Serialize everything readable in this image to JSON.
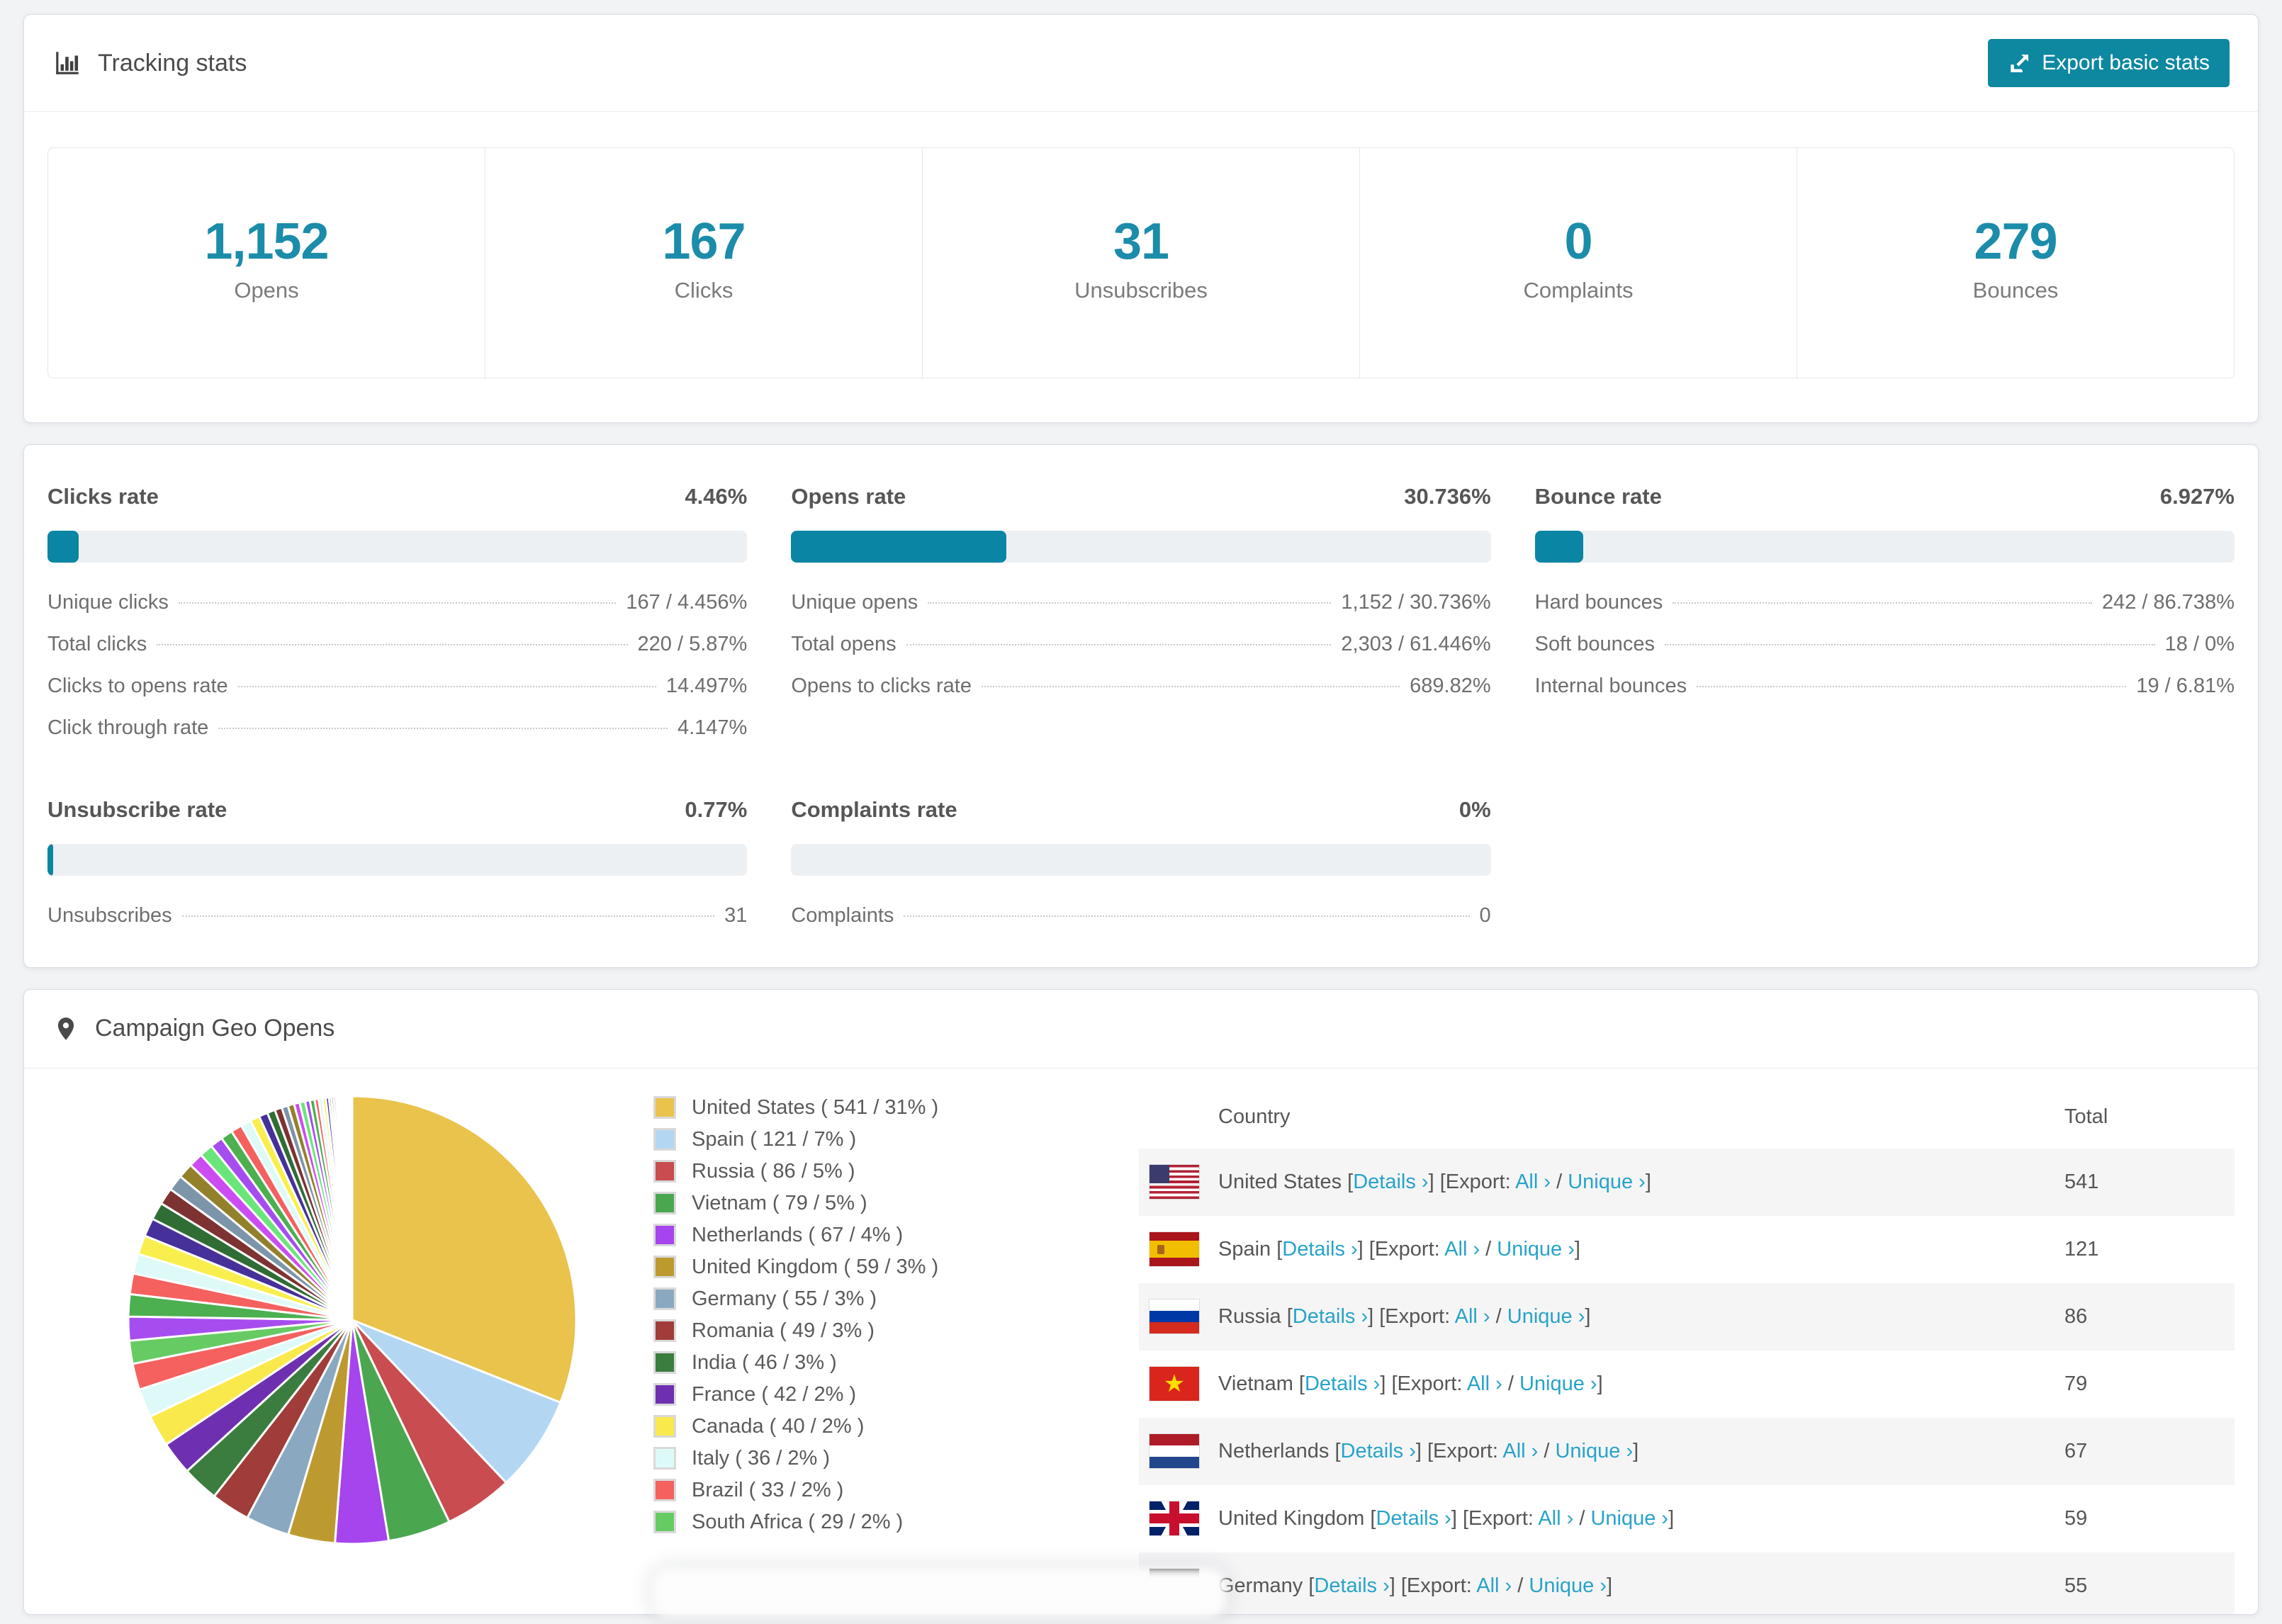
{
  "colors": {
    "accent_teal": "#0e87a1",
    "bar_fill": "#0a86a4",
    "stat_number": "#1b8ca9",
    "link": "#28a3c9",
    "row_stripe": "#f5f5f6"
  },
  "tracking": {
    "title": "Tracking stats",
    "export_button": "Export basic stats",
    "stats": [
      {
        "value": "1,152",
        "label": "Opens"
      },
      {
        "value": "167",
        "label": "Clicks"
      },
      {
        "value": "31",
        "label": "Unsubscribes"
      },
      {
        "value": "0",
        "label": "Complaints"
      },
      {
        "value": "279",
        "label": "Bounces"
      }
    ]
  },
  "rates": {
    "panels": [
      {
        "title": "Clicks rate",
        "value": "4.46%",
        "percent": 4.46,
        "rows": [
          {
            "label": "Unique clicks",
            "value": "167 / 4.456%"
          },
          {
            "label": "Total clicks",
            "value": "220 / 5.87%"
          },
          {
            "label": "Clicks to opens rate",
            "value": "14.497%"
          },
          {
            "label": "Click through rate",
            "value": "4.147%"
          }
        ]
      },
      {
        "title": "Opens rate",
        "value": "30.736%",
        "percent": 30.736,
        "rows": [
          {
            "label": "Unique opens",
            "value": "1,152 / 30.736%"
          },
          {
            "label": "Total opens",
            "value": "2,303 / 61.446%"
          },
          {
            "label": "Opens to clicks rate",
            "value": "689.82%"
          }
        ]
      },
      {
        "title": "Bounce rate",
        "value": "6.927%",
        "percent": 6.927,
        "rows": [
          {
            "label": "Hard bounces",
            "value": "242 / 86.738%"
          },
          {
            "label": "Soft bounces",
            "value": "18 / 0%"
          },
          {
            "label": "Internal bounces",
            "value": "19 / 6.81%"
          }
        ]
      },
      {
        "title": "Unsubscribe rate",
        "value": "0.77%",
        "percent": 0.77,
        "rows": [
          {
            "label": "Unsubscribes",
            "value": "31"
          }
        ]
      },
      {
        "title": "Complaints rate",
        "value": "0%",
        "percent": 0,
        "rows": [
          {
            "label": "Complaints",
            "value": "0"
          }
        ]
      }
    ]
  },
  "geo": {
    "title": "Campaign Geo Opens",
    "legend": [
      "United States ( 541 / 31% )",
      "Spain ( 121 / 7% )",
      "Russia ( 86 / 5% )",
      "Vietnam ( 79 / 5% )",
      "Netherlands ( 67 / 4% )",
      "United Kingdom ( 59 / 3% )",
      "Germany ( 55 / 3% )",
      "Romania ( 49 / 3% )",
      "India ( 46 / 3% )",
      "France ( 42 / 2% )",
      "Canada ( 40 / 2% )",
      "Italy ( 36 / 2% )",
      "Brazil ( 33 / 2% )",
      "South Africa ( 29 / 2% )"
    ],
    "table": {
      "headers": [
        "Country",
        "Total"
      ],
      "links": {
        "details": "Details ›",
        "export_label": "Export:",
        "all": "All ›",
        "unique": "Unique ›"
      },
      "rows": [
        {
          "country": "United States",
          "flag": "us",
          "total": "541"
        },
        {
          "country": "Spain",
          "flag": "es",
          "total": "121"
        },
        {
          "country": "Russia",
          "flag": "ru",
          "total": "86"
        },
        {
          "country": "Vietnam",
          "flag": "vn",
          "total": "79"
        },
        {
          "country": "Netherlands",
          "flag": "nl",
          "total": "67"
        },
        {
          "country": "United Kingdom",
          "flag": "gb",
          "total": "59"
        },
        {
          "country": "Germany",
          "flag": "de",
          "total": "55"
        }
      ]
    }
  },
  "chart_data": {
    "type": "pie",
    "title": "Campaign Geo Opens",
    "unit": "opens",
    "legend_position": "right",
    "start_angle_deg": 0,
    "direction": "clockwise",
    "slices": [
      {
        "label": "United States",
        "value": 541,
        "pct": 31,
        "color": "#e9c34c"
      },
      {
        "label": "Spain",
        "value": 121,
        "pct": 7,
        "color": "#b3d7f2"
      },
      {
        "label": "Russia",
        "value": 86,
        "pct": 5,
        "color": "#c84c50"
      },
      {
        "label": "Vietnam",
        "value": 79,
        "pct": 5,
        "color": "#4aa750"
      },
      {
        "label": "Netherlands",
        "value": 67,
        "pct": 4,
        "color": "#a644ee"
      },
      {
        "label": "United Kingdom",
        "value": 59,
        "pct": 3,
        "color": "#bd9a30"
      },
      {
        "label": "Germany",
        "value": 55,
        "pct": 3,
        "color": "#8aa9c0"
      },
      {
        "label": "Romania",
        "value": 49,
        "pct": 3,
        "color": "#a03c3a"
      },
      {
        "label": "India",
        "value": 46,
        "pct": 3,
        "color": "#3b7d3f"
      },
      {
        "label": "France",
        "value": 42,
        "pct": 2,
        "color": "#6e30b0"
      },
      {
        "label": "Canada",
        "value": 40,
        "pct": 2,
        "color": "#fae94d"
      },
      {
        "label": "Italy",
        "value": 36,
        "pct": 2,
        "color": "#defaf8"
      },
      {
        "label": "Brazil",
        "value": 33,
        "pct": 2,
        "color": "#f4615f"
      },
      {
        "label": "South Africa",
        "value": 29,
        "pct": 2,
        "color": "#66cb63"
      }
    ],
    "others": {
      "label": "Other countries (many small slices)",
      "values": [
        30,
        28,
        26,
        25,
        24,
        23,
        22,
        21,
        20,
        19,
        18,
        17,
        16,
        15,
        14,
        13,
        12,
        11,
        10,
        9,
        8,
        8,
        7,
        7,
        6,
        6,
        5,
        5,
        4,
        4,
        3,
        3,
        3,
        2,
        2,
        2,
        2,
        1,
        1,
        1,
        1,
        1,
        1,
        1,
        1,
        1,
        1,
        1,
        1
      ],
      "palette": [
        "#a64df0",
        "#4caf50",
        "#f4615f",
        "#defaf8",
        "#f8ef4e",
        "#46309a",
        "#2f6d35",
        "#7e3333",
        "#7d95a9",
        "#93802a",
        "#cb4df2",
        "#6ae57a"
      ]
    }
  }
}
